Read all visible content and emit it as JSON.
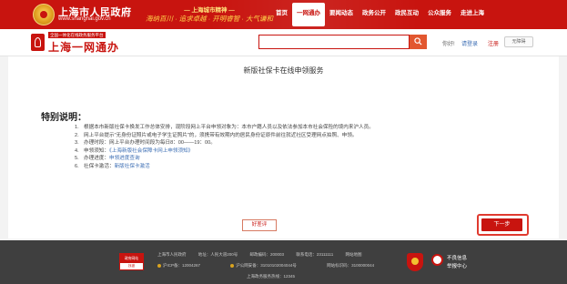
{
  "header": {
    "site_title": "上海市人民政府",
    "site_url": "www.shanghai.gov.cn",
    "slogan_top": "— 上海城市精神 —",
    "slogan_bottom": "海纳百川 · 追求卓越 · 开明睿智 · 大气谦和",
    "nav": [
      {
        "label": "首页",
        "active": false
      },
      {
        "label": "一网通办",
        "active": true
      },
      {
        "label": "要闻动态",
        "active": false
      },
      {
        "label": "政务公开",
        "active": false
      },
      {
        "label": "政民互动",
        "active": false
      },
      {
        "label": "公众服务",
        "active": false
      },
      {
        "label": "走进上海",
        "active": false
      }
    ]
  },
  "subheader": {
    "logo_tag": "全国一体化在线政务服务平台",
    "logo_name": "上海一网通办",
    "search_placeholder": "",
    "greeting": "你好!",
    "login": "请登录",
    "register": "注册",
    "a11y": "无障碍"
  },
  "content": {
    "page_title": "新版社保卡在线申领服务",
    "notice_heading": "特别说明：",
    "items": [
      {
        "num": "1.",
        "text": "根据本市新版社保卡换发工作总体安排，现阶段网上平台申领对象为：本市户籍人员以及依法参加本市社会保险的境内来沪人员。",
        "link": ""
      },
      {
        "num": "2.",
        "text": "网上平台提示\"无身份证照片或电子学生证照片\"的，须携带有效期内的居民身份证原件前往就近社区受理网点拍照、申领。",
        "link": ""
      },
      {
        "num": "3.",
        "text": "办理时段：网上平台办理时间段为每日8：00——19：00。",
        "link": ""
      },
      {
        "num": "4.",
        "text": "申领须知：",
        "link": "《上海新版社会保障卡网上申领须知》"
      },
      {
        "num": "5.",
        "text": "办理进度：",
        "link": "申领进度查询"
      },
      {
        "num": "6.",
        "text": "社保卡激活：",
        "link": "新版社保卡激活"
      }
    ],
    "feedback_label": "好差评",
    "next_label": "下一步"
  },
  "footer": {
    "gov_badge_top": "政府网站",
    "gov_badge_bottom": "找错",
    "row1": [
      "上海市人民政府",
      "地址：人民大道200号",
      "邮政编码：200003",
      "联系电话：23111111",
      "网站地图"
    ],
    "icp": "沪ICP备：12004267",
    "police": "沪公网安备：31010102004044号",
    "idcode": "网站标识码：3100000044",
    "row3": "上海政务服务热线：12345",
    "report_line1": "不良信息",
    "report_line2": "举报中心"
  }
}
